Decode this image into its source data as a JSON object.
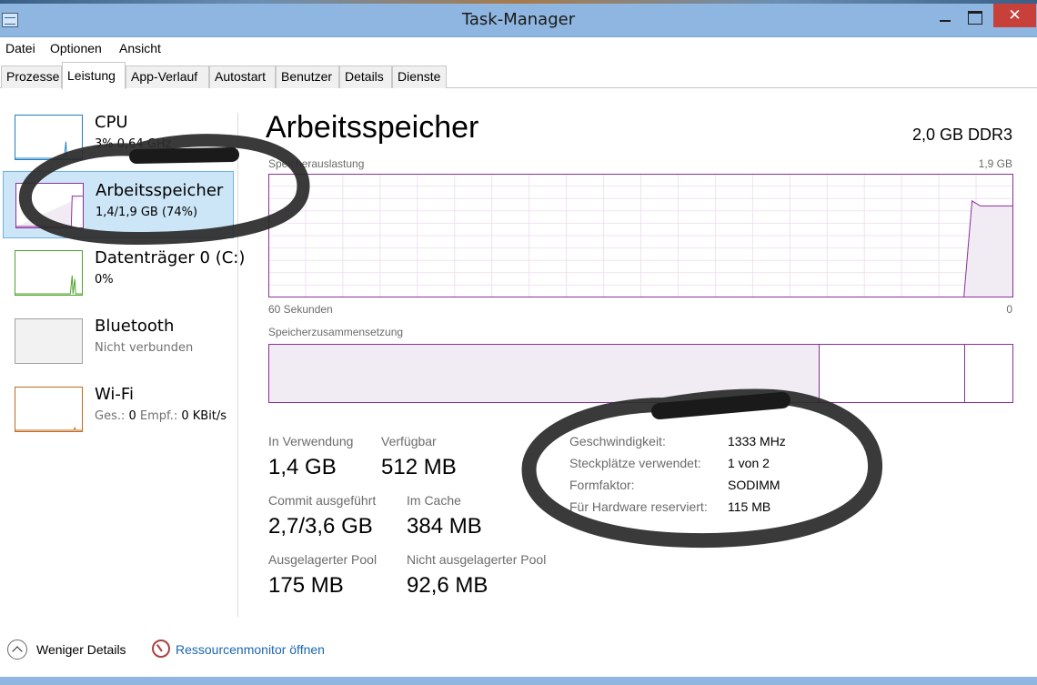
{
  "window": {
    "title": "Task-Manager",
    "close_glyph": "✕"
  },
  "menu": [
    "Datei",
    "Optionen",
    "Ansicht"
  ],
  "tabs": [
    "Prozesse",
    "Leistung",
    "App-Verlauf",
    "Autostart",
    "Benutzer",
    "Details",
    "Dienste"
  ],
  "active_tab": "Leistung",
  "sidebar": [
    {
      "title": "CPU",
      "subtitle": "3%  0,64 GHz",
      "color": "#1e7fc0"
    },
    {
      "title": "Arbeitsspeicher",
      "subtitle": "1,4/1,9 GB (74%)",
      "color": "#8b2f9b"
    },
    {
      "title": "Datenträger 0 (C:)",
      "subtitle": "0%",
      "color": "#4ca32a"
    },
    {
      "title": "Bluetooth",
      "subtitle": "Nicht verbunden",
      "color": "#a0a0a0"
    },
    {
      "title": "Wi-Fi",
      "subtitle_label_send": "Ges.:",
      "subtitle_send": "0",
      "subtitle_label_recv": "Empf.:",
      "subtitle_recv": "0 KBit/s",
      "color": "#c06a20"
    }
  ],
  "main": {
    "title": "Arbeitsspeicher",
    "spec": "2,0 GB DDR3",
    "usage_label": "Speicherauslastung",
    "usage_max": "1,9 GB",
    "time_left": "60 Sekunden",
    "time_right": "0",
    "composition_label": "Speicherzusammensetzung",
    "composition": {
      "in_use_fraction": 0.74,
      "standby_end_fraction": 0.936
    },
    "usage_series": {
      "levels": [
        0,
        0,
        0,
        0,
        0,
        0,
        0,
        0,
        0,
        0.78,
        0.74,
        0.74,
        0.74,
        0.74,
        0.74
      ]
    }
  },
  "stats": {
    "in_use_label": "In Verwendung",
    "in_use": "1,4 GB",
    "available_label": "Verfügbar",
    "available": "512 MB",
    "committed_label": "Commit ausgeführt",
    "committed": "2,7/3,6 GB",
    "cached_label": "Im Cache",
    "cached": "384 MB",
    "paged_label": "Ausgelagerter Pool",
    "paged": "175 MB",
    "nonpaged_label": "Nicht ausgelagerter Pool",
    "nonpaged": "92,6 MB"
  },
  "details": [
    {
      "key": "Geschwindigkeit:",
      "value": "1333 MHz"
    },
    {
      "key": "Steckplätze verwendet:",
      "value": "1 von 2"
    },
    {
      "key": "Formfaktor:",
      "value": "SODIMM"
    },
    {
      "key": "Für Hardware reserviert:",
      "value": "115 MB"
    }
  ],
  "footer": {
    "fewer_details": "Weniger Details",
    "resource_monitor": "Ressourcenmonitor öffnen"
  },
  "colors": {
    "memory": "#8b2f9b",
    "selected": "#cde6f7",
    "link": "#1a66b2"
  }
}
